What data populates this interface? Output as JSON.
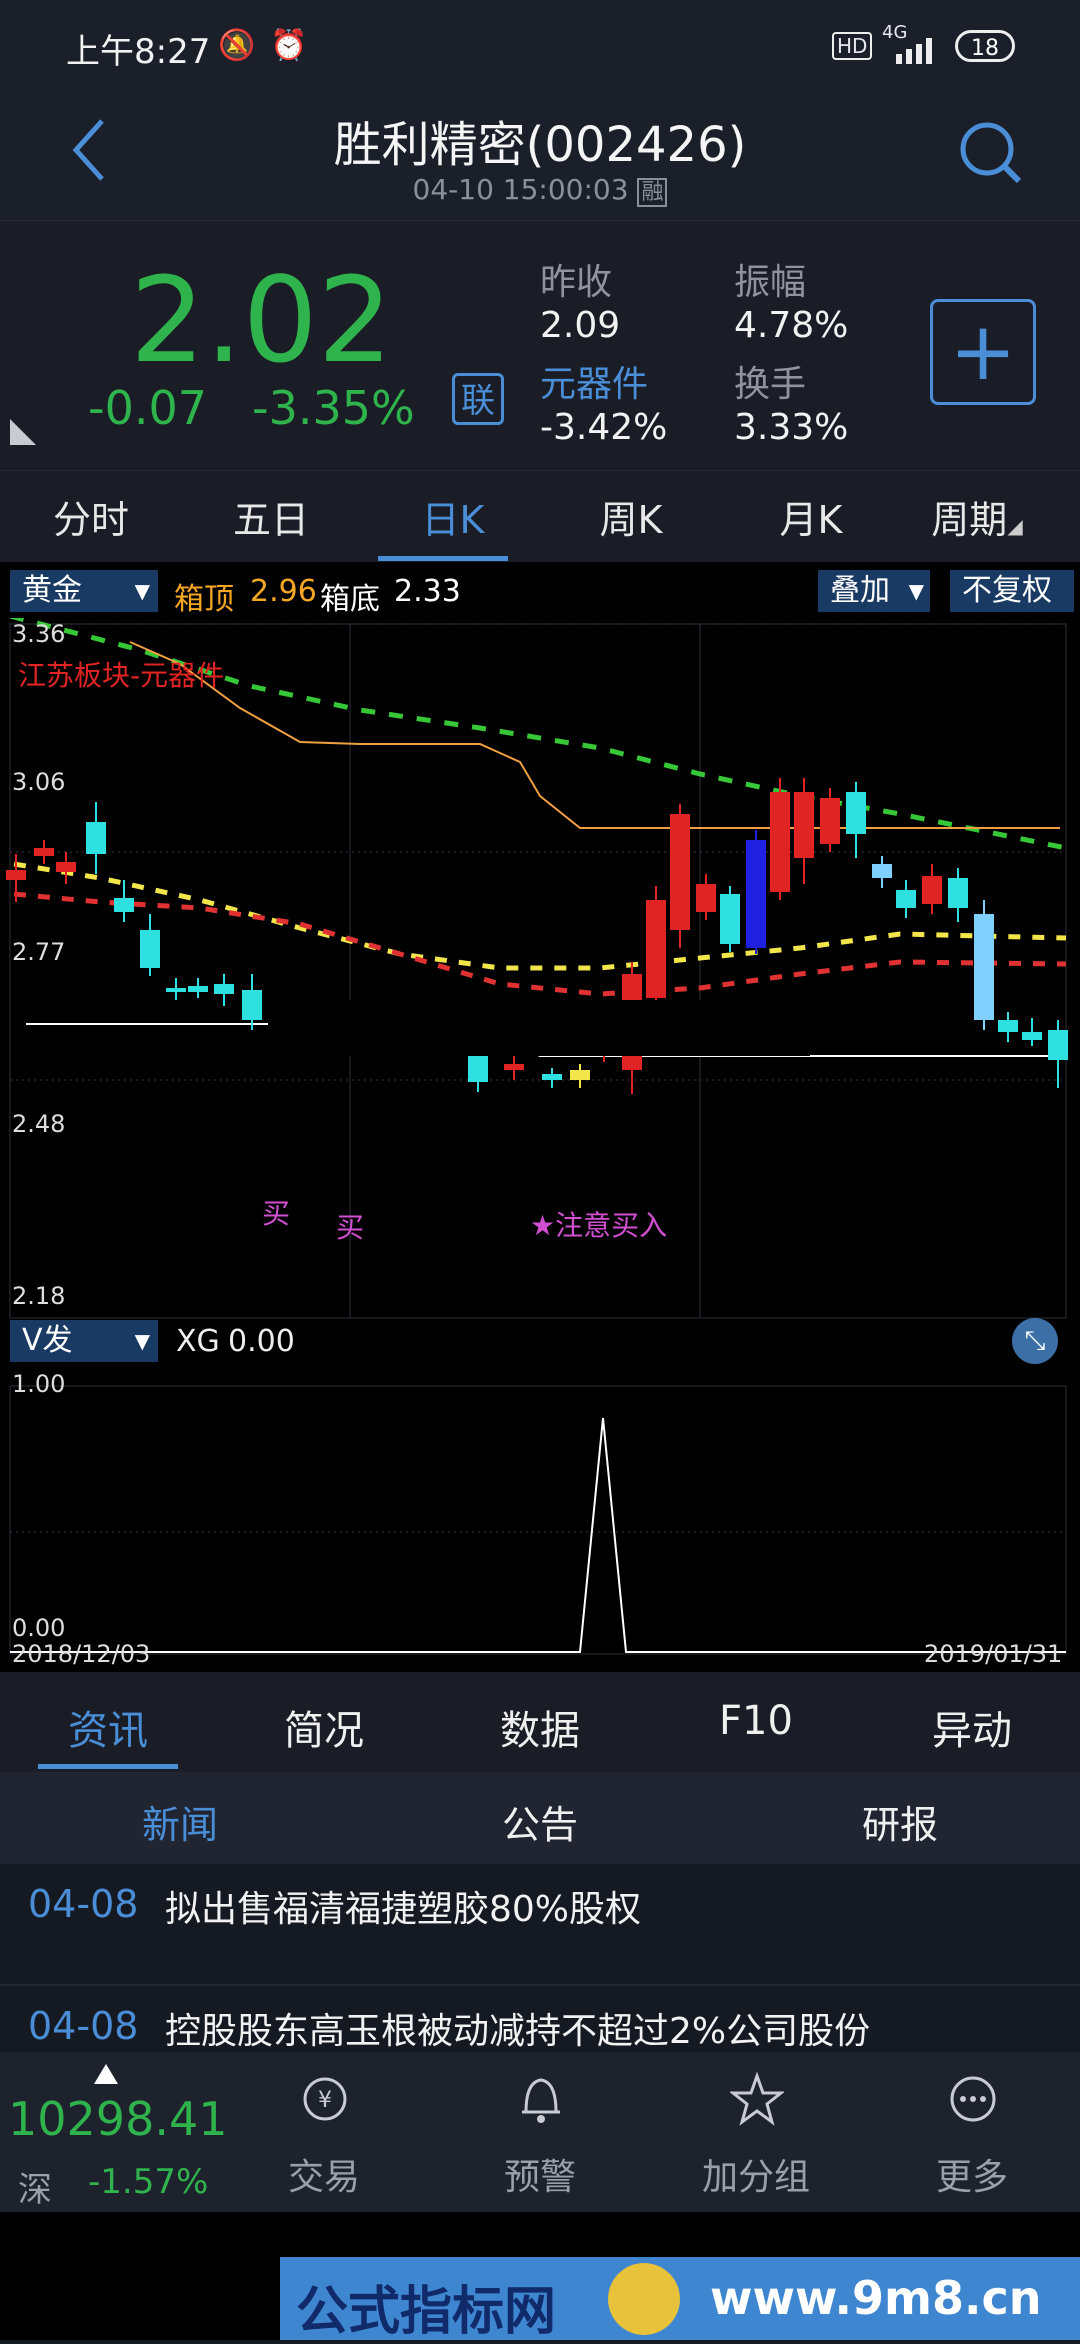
{
  "status": {
    "time": "上午8:27",
    "hd": "HD",
    "net": "4G",
    "battery": "18"
  },
  "header": {
    "title": "胜利精密(002426)",
    "datetime": "04-10 15:00:03",
    "rong": "融"
  },
  "quote": {
    "price": "2.02",
    "change": "-0.07",
    "change_pct": "-3.35%",
    "lian": "联",
    "prev_close_label": "昨收",
    "prev_close": "2.09",
    "amplitude_label": "振幅",
    "amplitude": "4.78%",
    "sector_label": "元器件",
    "sector_pct": "-3.42%",
    "turnover_label": "换手",
    "turnover": "3.33%",
    "plus": "+"
  },
  "ktabs": [
    "分时",
    "五日",
    "日K",
    "周K",
    "月K",
    "周期"
  ],
  "chart_top": {
    "indicator": "黄金",
    "box_top_label": "箱顶",
    "box_top": "2.96",
    "box_bottom_label": "箱底",
    "box_bottom": "2.33",
    "overlay": "叠加",
    "adjust": "不复权",
    "sector_note": "江苏板块-元器件",
    "yticks": [
      "3.36",
      "3.06",
      "2.77",
      "2.48",
      "2.18"
    ],
    "signals": [
      "买",
      "买",
      "注意买入"
    ]
  },
  "chart_bottom": {
    "indicator": "V发",
    "xg_label": "XG",
    "xg_value": "0.00",
    "yticks": [
      "1.00",
      "0.00"
    ],
    "date_start": "2018/12/03",
    "date_end": "2019/01/31"
  },
  "chart_data": {
    "type": "line",
    "title": "",
    "x": [
      "2018/12/03",
      "2019/01/31"
    ],
    "ylim": [
      2.18,
      3.36
    ],
    "series": [
      {
        "name": "XG",
        "values": [
          0,
          0,
          1,
          0,
          0
        ]
      }
    ]
  },
  "btabs": [
    "资讯",
    "简况",
    "数据",
    "F10",
    "异动"
  ],
  "subtabs": [
    "新闻",
    "公告",
    "研报"
  ],
  "news": [
    {
      "date": "04-08",
      "text": "拟出售福清福捷塑胶80%股权"
    },
    {
      "date": "04-08",
      "text": "控股股东高玉根被动减持不超过2%公司股份"
    }
  ],
  "bnav": {
    "index_value": "10298.41",
    "index_label": "深",
    "index_pct": "-1.57%",
    "items": [
      "交易",
      "预警",
      "加分组",
      "更多"
    ]
  },
  "footer": {
    "brand": "公式指标网",
    "url": "www.9m8.cn"
  }
}
